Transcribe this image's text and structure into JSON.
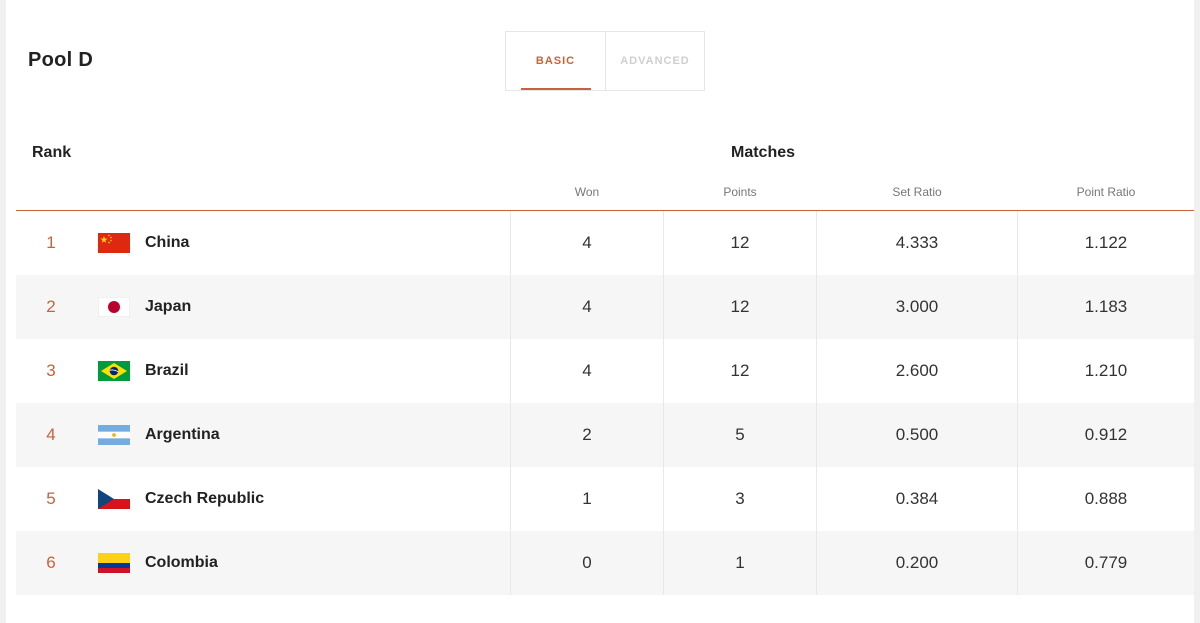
{
  "pool": {
    "title": "Pool D"
  },
  "tabs": {
    "basic": "BASIC",
    "advanced": "ADVANCED"
  },
  "table": {
    "rank_header": "Rank",
    "matches_header": "Matches",
    "columns": [
      "Won",
      "Points",
      "Set Ratio",
      "Point Ratio"
    ],
    "rows": [
      {
        "rank": "1",
        "flag": "china-flag",
        "country": "China",
        "won": "4",
        "points": "12",
        "set_ratio": "4.333",
        "point_ratio": "1.122"
      },
      {
        "rank": "2",
        "flag": "japan-flag",
        "country": "Japan",
        "won": "4",
        "points": "12",
        "set_ratio": "3.000",
        "point_ratio": "1.183"
      },
      {
        "rank": "3",
        "flag": "brazil-flag",
        "country": "Brazil",
        "won": "4",
        "points": "12",
        "set_ratio": "2.600",
        "point_ratio": "1.210"
      },
      {
        "rank": "4",
        "flag": "argentina-flag",
        "country": "Argentina",
        "won": "2",
        "points": "5",
        "set_ratio": "0.500",
        "point_ratio": "0.912"
      },
      {
        "rank": "5",
        "flag": "czech-republic-flag",
        "country": "Czech Republic",
        "won": "1",
        "points": "3",
        "set_ratio": "0.384",
        "point_ratio": "0.888"
      },
      {
        "rank": "6",
        "flag": "colombia-flag",
        "country": "Colombia",
        "won": "0",
        "points": "1",
        "set_ratio": "0.200",
        "point_ratio": "0.779"
      }
    ]
  },
  "colors": {
    "accent": "#c8623a",
    "alt_row": "#f6f6f6",
    "inactive_tab": "#cfcfcf"
  }
}
